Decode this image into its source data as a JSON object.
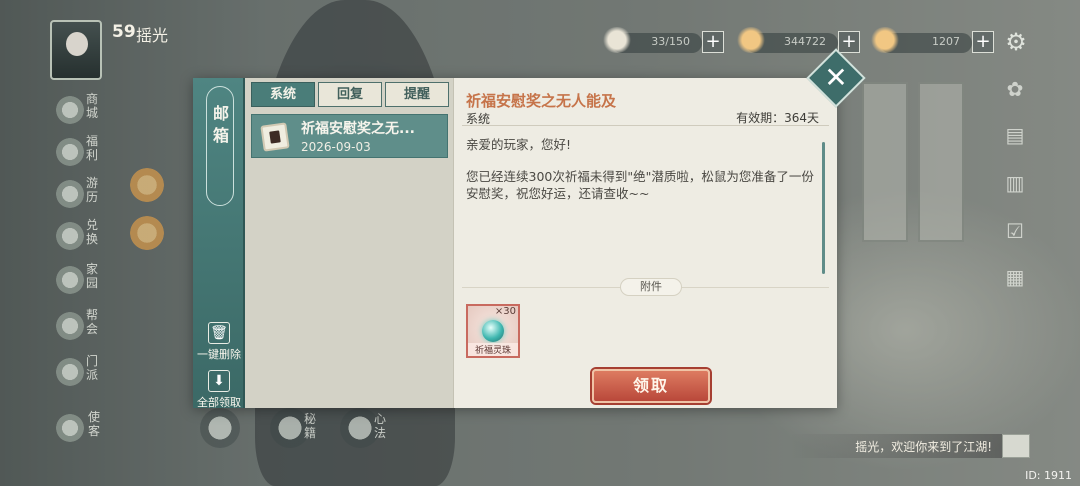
{
  "player": {
    "level": "59",
    "name": "摇光"
  },
  "sidebar": {
    "items": [
      {
        "label": "商城"
      },
      {
        "label": "福利"
      },
      {
        "label": "游历"
      },
      {
        "label": "兑换"
      },
      {
        "label": "家园"
      },
      {
        "label": "帮会"
      },
      {
        "label": "门派"
      },
      {
        "label": "使客"
      }
    ]
  },
  "resources": [
    {
      "icon": "cloud-icon",
      "value": "33/150"
    },
    {
      "icon": "coin-icon",
      "value": "344722"
    },
    {
      "icon": "gold-ingot-icon",
      "value": "1207"
    }
  ],
  "bottom_bar": {
    "items": [
      {
        "label": "秘籍"
      },
      {
        "label": "心法"
      }
    ]
  },
  "chat": {
    "message": "摇光，欢迎你来到了江湖!"
  },
  "uid": "ID: 1911",
  "mailbox": {
    "title": "邮箱",
    "tabs": [
      {
        "label": "系统",
        "active": true
      },
      {
        "label": "回复",
        "active": false
      },
      {
        "label": "提醒",
        "active": false
      }
    ],
    "actions": {
      "delete_all": "一键删除",
      "claim_all": "全部领取"
    },
    "mails": [
      {
        "title": "祈福安慰奖之无...",
        "date": "2026-09-03"
      }
    ],
    "detail": {
      "subject": "祈福安慰奖之无人能及",
      "sender": "系统",
      "validity": "有效期：364天",
      "greeting": "亲爱的玩家，您好!",
      "body": "您已经连续300次祈福未得到\"绝\"潜质啦，松鼠为您准备了一份安慰奖，祝您好运，还请查收~~",
      "attachment_label": "附件",
      "attachments": [
        {
          "name": "祈福灵珠",
          "count": "×30"
        }
      ],
      "claim_label": "领取"
    }
  },
  "colors": {
    "teal": "#4a7d79",
    "claim_red": "#c65a46",
    "subject_orange": "#c6744a",
    "panel_bg": "#eeece3"
  }
}
